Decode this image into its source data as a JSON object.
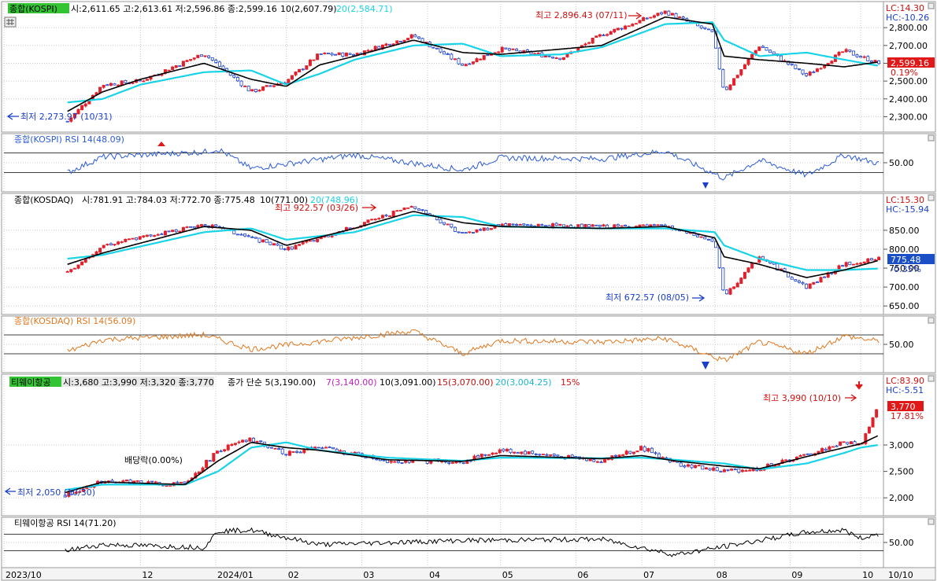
{
  "window": {
    "size_note": ""
  },
  "colors": {
    "up": "#e0202a",
    "down": "#1a3fc8",
    "ma_short": "#000000",
    "ma_long": "#19d4e6",
    "rsi_kospi": "#2a5bd7",
    "rsi_kosdaq": "#e07820",
    "rsi_tway": "#000000",
    "grid": "#c8c8c8",
    "label_green": "#33c433",
    "price_box": "#e01818",
    "price_box_blue": "#1a4fc8"
  },
  "panels": {
    "kospi": {
      "name": "종합(KOSPI)",
      "ohlc": "시:2,611.65 고:2,613.61 저:2,596.86 종:2,599.16",
      "ma10": "10(2,607.79)",
      "ma20": "20(2,584.71)",
      "lc": "LC:14.30",
      "hc": "HC:-10.26",
      "price_tag": "2,599.16",
      "change": "0.19%",
      "high_note": "최고 2,896.43 (07/11)",
      "low_note": "최저 2,273.97 (10/31)",
      "y_ticks": [
        "2,800.00",
        "2,700.00",
        "2,600.00",
        "2,500.00",
        "2,400.00",
        "2,300.00"
      ]
    },
    "kospi_rsi": {
      "name": "종합(KOSPI) RSI 14(48.09)",
      "y_ticks": [
        "50.00"
      ]
    },
    "kosdaq": {
      "name": "종합(KOSDAQ)",
      "ohlc": "시:781.91 고:784.03 저:772.70 종:775.48",
      "ma10": "10(771.00)",
      "ma20": "20(748.96)",
      "lc": "LC:15.30",
      "hc": "HC:-15.94",
      "price_tag": "775.48",
      "change": "-0.35%",
      "high_note": "최고 922.57 (03/26)",
      "low_note": "최저 672.57 (08/05)",
      "y_ticks": [
        "850.00",
        "800.00",
        "750.00",
        "700.00",
        "650.00"
      ]
    },
    "kosdaq_rsi": {
      "name": "종합(KOSDAQ) RSI 14(56.09)",
      "y_ticks": [
        "50.00"
      ]
    },
    "tway": {
      "name": "티웨이항공",
      "ohlc": "시:3,680 고:3,990 저:3,320 종:3,770",
      "ma_title": "종가 단순 5(3,190.00)",
      "ma7": "7(3,140.00)",
      "ma10": "10(3,091.00)",
      "ma15": "15(3,070.00)",
      "ma20": "20(3,004.25)",
      "pct": "15%",
      "lc": "LC:83.90",
      "hc": "HC:-5.51",
      "price_tag": "3,770",
      "change": "17.81%",
      "high_note": "최고 3,990 (10/10)",
      "low_note": "최저 2,050 (10/30)",
      "div_note": "배당락(0.00%)",
      "y_ticks": [
        "3,000",
        "2,500",
        "2,000"
      ]
    },
    "tway_rsi": {
      "name": "티웨이항공 RSI 14(71.20)",
      "y_ticks": [
        "50.00"
      ]
    }
  },
  "x_axis": [
    "2023/10",
    "12",
    "2024/01",
    "02",
    "03",
    "04",
    "05",
    "06",
    "07",
    "08",
    "09",
    "10"
  ],
  "x_axis_right": "10/10",
  "chart_data": [
    {
      "type": "line",
      "title": "종합(KOSPI)",
      "note": "candlestick with MA10 and MA20; anchor closes read off axis",
      "x": [
        "2023/10/31",
        "2023/11/15",
        "2023/12/01",
        "2023/12/28",
        "2024/01/17",
        "2024/02/01",
        "2024/02/15",
        "2024/03/01",
        "2024/03/26",
        "2024/04/16",
        "2024/05/02",
        "2024/05/28",
        "2024/06/14",
        "2024/07/11",
        "2024/07/31",
        "2024/08/05",
        "2024/08/20",
        "2024/09/09",
        "2024/09/25",
        "2024/10/10"
      ],
      "series": [
        {
          "name": "종합(KOSPI)",
          "values": [
            2274,
            2480,
            2500,
            2655,
            2440,
            2500,
            2650,
            2650,
            2755,
            2590,
            2680,
            2630,
            2760,
            2890,
            2770,
            2440,
            2700,
            2530,
            2670,
            2599
          ]
        },
        {
          "name": "10",
          "values": [
            2330,
            2440,
            2510,
            2600,
            2510,
            2470,
            2590,
            2640,
            2730,
            2660,
            2650,
            2680,
            2700,
            2860,
            2820,
            2640,
            2620,
            2600,
            2580,
            2608
          ]
        },
        {
          "name": "20",
          "values": [
            2380,
            2400,
            2480,
            2550,
            2560,
            2480,
            2540,
            2620,
            2700,
            2710,
            2640,
            2650,
            2690,
            2820,
            2830,
            2730,
            2640,
            2660,
            2620,
            2585
          ]
        }
      ],
      "ylim": [
        2240,
        2920
      ],
      "y_ticks": [
        2800,
        2700,
        2600,
        2500,
        2400,
        2300
      ]
    },
    {
      "type": "line",
      "title": "종합(KOSPI) RSI 14(48.09)",
      "x": [
        "2023/10/31",
        "2023/11/15",
        "2023/12/28",
        "2024/01/03",
        "2024/01/17",
        "2024/03/01",
        "2024/04/16",
        "2024/05/02",
        "2024/06/14",
        "2024/07/11",
        "2024/08/05",
        "2024/08/20",
        "2024/09/09",
        "2024/09/25",
        "2024/10/10"
      ],
      "series": [
        {
          "name": "RSI 14",
          "values": [
            30,
            62,
            72,
            78,
            38,
            66,
            35,
            60,
            58,
            74,
            18,
            55,
            24,
            66,
            48
          ]
        }
      ],
      "ylim": [
        0,
        100
      ],
      "y_ticks": [
        50
      ]
    },
    {
      "type": "line",
      "title": "종합(KOSDAQ)",
      "x": [
        "2023/10/31",
        "2023/11/15",
        "2023/12/28",
        "2024/01/17",
        "2024/02/01",
        "2024/03/01",
        "2024/03/26",
        "2024/04/16",
        "2024/05/02",
        "2024/06/14",
        "2024/07/11",
        "2024/08/01",
        "2024/08/05",
        "2024/08/20",
        "2024/09/09",
        "2024/09/25",
        "2024/10/10"
      ],
      "series": [
        {
          "name": "종합(KOSDAQ)",
          "values": [
            740,
            810,
            866,
            830,
            800,
            860,
            915,
            840,
            865,
            860,
            860,
            820,
            673,
            780,
            700,
            760,
            775
          ]
        },
        {
          "name": "10",
          "values": [
            760,
            790,
            860,
            850,
            810,
            855,
            900,
            870,
            860,
            855,
            860,
            830,
            780,
            760,
            725,
            745,
            771
          ]
        },
        {
          "name": "20",
          "values": [
            775,
            785,
            845,
            855,
            825,
            845,
            890,
            885,
            860,
            855,
            855,
            845,
            810,
            775,
            745,
            745,
            749
          ]
        }
      ],
      "ylim": [
        640,
        935
      ],
      "y_ticks": [
        850,
        800,
        750,
        700,
        650
      ]
    },
    {
      "type": "line",
      "title": "종합(KOSDAQ) RSI 14(56.09)",
      "x": [
        "2023/10/31",
        "2023/11/15",
        "2023/12/28",
        "2024/01/17",
        "2024/03/26",
        "2024/04/16",
        "2024/05/02",
        "2024/06/14",
        "2024/07/11",
        "2024/08/05",
        "2024/08/20",
        "2024/09/09",
        "2024/09/25",
        "2024/10/10"
      ],
      "series": [
        {
          "name": "RSI 14",
          "values": [
            35,
            60,
            70,
            40,
            78,
            30,
            58,
            55,
            62,
            15,
            55,
            30,
            68,
            56
          ]
        }
      ],
      "ylim": [
        0,
        100
      ],
      "y_ticks": [
        50
      ]
    },
    {
      "type": "line",
      "title": "티웨이항공",
      "x": [
        "2023/10/30",
        "2023/11/15",
        "2023/12/20",
        "2024/01/03",
        "2024/01/17",
        "2024/02/01",
        "2024/02/15",
        "2024/03/15",
        "2024/04/16",
        "2024/05/02",
        "2024/06/14",
        "2024/07/01",
        "2024/07/15",
        "2024/08/05",
        "2024/08/20",
        "2024/09/09",
        "2024/09/25",
        "2024/10/02",
        "2024/10/10"
      ],
      "series": [
        {
          "name": "종가",
          "values": [
            2050,
            2330,
            2250,
            2900,
            3100,
            2850,
            2950,
            2700,
            2680,
            2900,
            2700,
            2950,
            2650,
            2500,
            2550,
            2800,
            3050,
            3000,
            3770
          ]
        },
        {
          "name": "5",
          "values": [
            2100,
            2300,
            2250,
            2700,
            3050,
            2950,
            2900,
            2720,
            2690,
            2800,
            2740,
            2800,
            2700,
            2600,
            2550,
            2780,
            2950,
            3020,
            3190
          ]
        },
        {
          "name": "20",
          "values": [
            2150,
            2250,
            2250,
            2500,
            2950,
            3050,
            2900,
            2760,
            2700,
            2760,
            2750,
            2760,
            2720,
            2650,
            2540,
            2650,
            2850,
            2950,
            3004
          ]
        }
      ],
      "ylim": [
        1750,
        4250
      ],
      "y_ticks": [
        3000,
        2500,
        2000
      ]
    },
    {
      "type": "line",
      "title": "티웨이항공 RSI 14(71.20)",
      "x": [
        "2023/10/30",
        "2023/11/15",
        "2023/12/28",
        "2024/01/03",
        "2024/01/17",
        "2024/02/15",
        "2024/04/16",
        "2024/06/14",
        "2024/07/15",
        "2024/08/05",
        "2024/09/09",
        "2024/09/25",
        "2024/10/02",
        "2024/10/10"
      ],
      "series": [
        {
          "name": "RSI 14",
          "values": [
            30,
            45,
            38,
            78,
            80,
            45,
            55,
            58,
            20,
            40,
            75,
            80,
            60,
            71
          ]
        }
      ],
      "ylim": [
        0,
        100
      ],
      "y_ticks": [
        50
      ]
    }
  ]
}
